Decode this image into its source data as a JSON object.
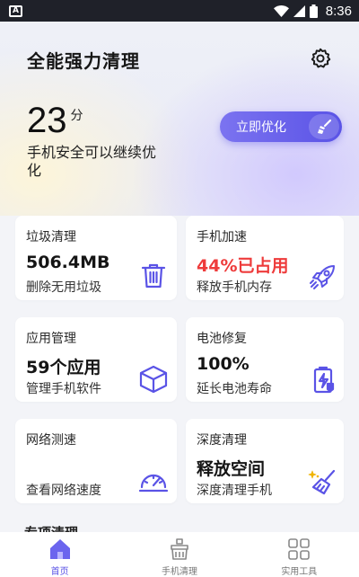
{
  "status_bar": {
    "time": "8:36",
    "app_badge": "A"
  },
  "header": {
    "title": "全能强力清理"
  },
  "summary": {
    "score": "23",
    "score_unit": "分",
    "description": "手机安全可以继续优化",
    "optimize_button": "立即优化"
  },
  "cards": [
    {
      "title": "垃圾清理",
      "value": "506.4MB",
      "subtitle": "删除无用垃圾",
      "icon": "trash-icon"
    },
    {
      "title": "手机加速",
      "value": "44%已占用",
      "subtitle": "释放手机内存",
      "icon": "rocket-icon",
      "value_color": "#ee3b3b"
    },
    {
      "title": "应用管理",
      "value": "59个应用",
      "subtitle": "管理手机软件",
      "icon": "cube-icon"
    },
    {
      "title": "电池修复",
      "value": "100%",
      "subtitle": "延长电池寿命",
      "icon": "battery-icon"
    },
    {
      "title": "网络测速",
      "value": "",
      "subtitle": "查看网络速度",
      "icon": "speedometer-icon"
    },
    {
      "title": "深度清理",
      "value": "释放空间",
      "subtitle": "深度清理手机",
      "icon": "broom-icon"
    }
  ],
  "section": {
    "title": "专项清理"
  },
  "tab_bar": {
    "items": [
      {
        "label": "首页",
        "icon": "home-icon",
        "active": true
      },
      {
        "label": "手机清理",
        "icon": "cleaner-icon",
        "active": false
      },
      {
        "label": "实用工具",
        "icon": "grid-icon",
        "active": false
      }
    ]
  },
  "colors": {
    "accent": "#5a53e6",
    "alert": "#ee3b3b"
  }
}
